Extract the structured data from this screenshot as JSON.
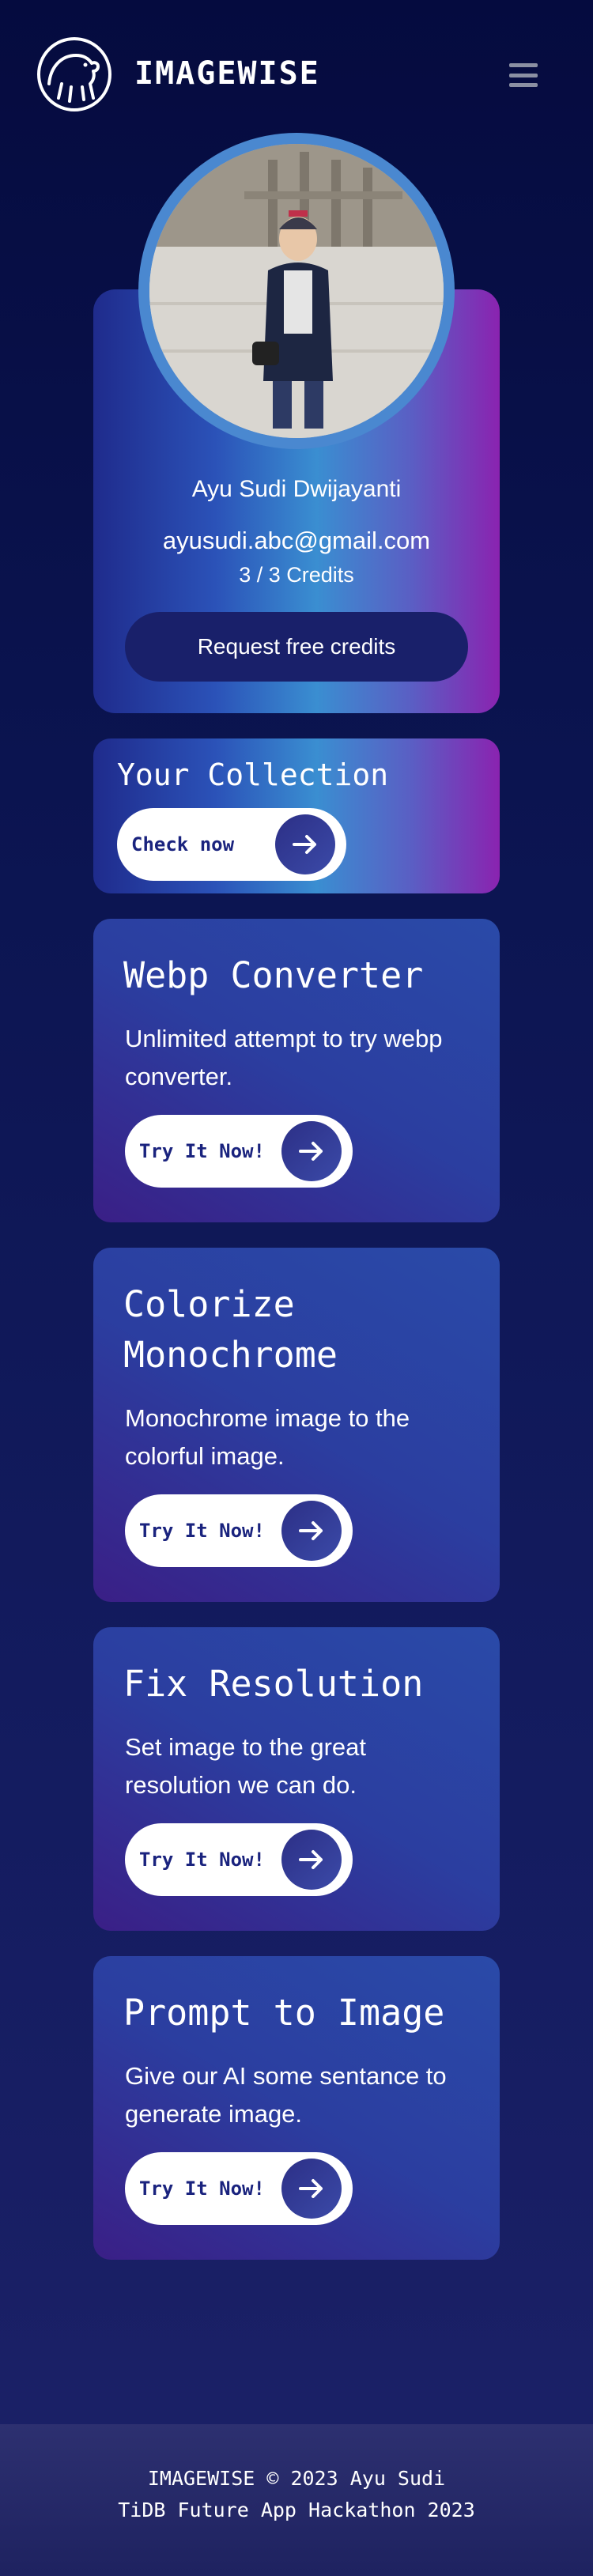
{
  "header": {
    "brand": "IMAGEWISE",
    "logo_icon": "bear-logo-icon",
    "menu_icon": "hamburger-menu-icon"
  },
  "profile": {
    "name": "Ayu Sudi Dwijayanti",
    "email": "ayusudi.abc@gmail.com",
    "credits": "3 / 3 Credits",
    "request_button": "Request free credits"
  },
  "collection": {
    "title": "Your Collection",
    "button": "Check now"
  },
  "features": [
    {
      "title": "Webp Converter",
      "description": "Unlimited attempt to try webp converter.",
      "button": "Try It Now!"
    },
    {
      "title": "Colorize Monochrome",
      "description": "Monochrome image to the colorful image.",
      "button": "Try It Now!"
    },
    {
      "title": "Fix Resolution",
      "description": "Set image to the great resolution we can do.",
      "button": "Try It Now!"
    },
    {
      "title": "Prompt to Image",
      "description": "Give our AI some sentance to generate image.",
      "button": "Try It Now!"
    }
  ],
  "footer": {
    "line1": "IMAGEWISE © 2023 Ayu Sudi",
    "line2": "TiDB Future App Hackathon 2023"
  },
  "colors": {
    "background": "#0b1450",
    "button_text": "#1a237e",
    "request_button": "#19206a"
  }
}
